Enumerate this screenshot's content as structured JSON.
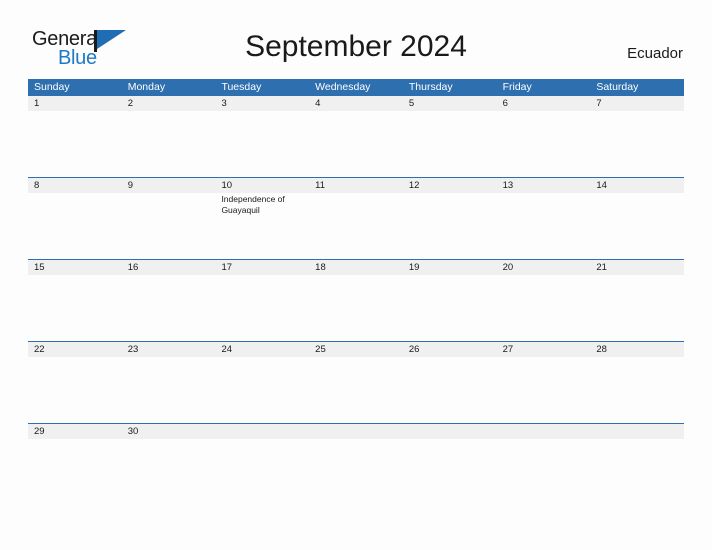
{
  "brand": {
    "name_top": "General",
    "name_bottom": "Blue",
    "flag_icon": "flag-triangle-icon",
    "accent_color": "#1f6eb5"
  },
  "header": {
    "title": "September 2024",
    "country": "Ecuador"
  },
  "theme": {
    "header_blue": "#2e6fb0",
    "date_band_gray": "#f0f0f0",
    "page_background": "#fdfdfd",
    "text_color": "#1a1a1a",
    "logo_blue": "#1f7ac4"
  },
  "calendar": {
    "weekdays": [
      "Sunday",
      "Monday",
      "Tuesday",
      "Wednesday",
      "Thursday",
      "Friday",
      "Saturday"
    ],
    "weeks": [
      {
        "days": [
          {
            "date": "1",
            "event": ""
          },
          {
            "date": "2",
            "event": ""
          },
          {
            "date": "3",
            "event": ""
          },
          {
            "date": "4",
            "event": ""
          },
          {
            "date": "5",
            "event": ""
          },
          {
            "date": "6",
            "event": ""
          },
          {
            "date": "7",
            "event": ""
          }
        ]
      },
      {
        "days": [
          {
            "date": "8",
            "event": ""
          },
          {
            "date": "9",
            "event": ""
          },
          {
            "date": "10",
            "event": "Independence of Guayaquil"
          },
          {
            "date": "11",
            "event": ""
          },
          {
            "date": "12",
            "event": ""
          },
          {
            "date": "13",
            "event": ""
          },
          {
            "date": "14",
            "event": ""
          }
        ]
      },
      {
        "days": [
          {
            "date": "15",
            "event": ""
          },
          {
            "date": "16",
            "event": ""
          },
          {
            "date": "17",
            "event": ""
          },
          {
            "date": "18",
            "event": ""
          },
          {
            "date": "19",
            "event": ""
          },
          {
            "date": "20",
            "event": ""
          },
          {
            "date": "21",
            "event": ""
          }
        ]
      },
      {
        "days": [
          {
            "date": "22",
            "event": ""
          },
          {
            "date": "23",
            "event": ""
          },
          {
            "date": "24",
            "event": ""
          },
          {
            "date": "25",
            "event": ""
          },
          {
            "date": "26",
            "event": ""
          },
          {
            "date": "27",
            "event": ""
          },
          {
            "date": "28",
            "event": ""
          }
        ]
      },
      {
        "days": [
          {
            "date": "29",
            "event": ""
          },
          {
            "date": "30",
            "event": ""
          },
          {
            "date": "",
            "event": ""
          },
          {
            "date": "",
            "event": ""
          },
          {
            "date": "",
            "event": ""
          },
          {
            "date": "",
            "event": ""
          },
          {
            "date": "",
            "event": ""
          }
        ]
      }
    ]
  }
}
